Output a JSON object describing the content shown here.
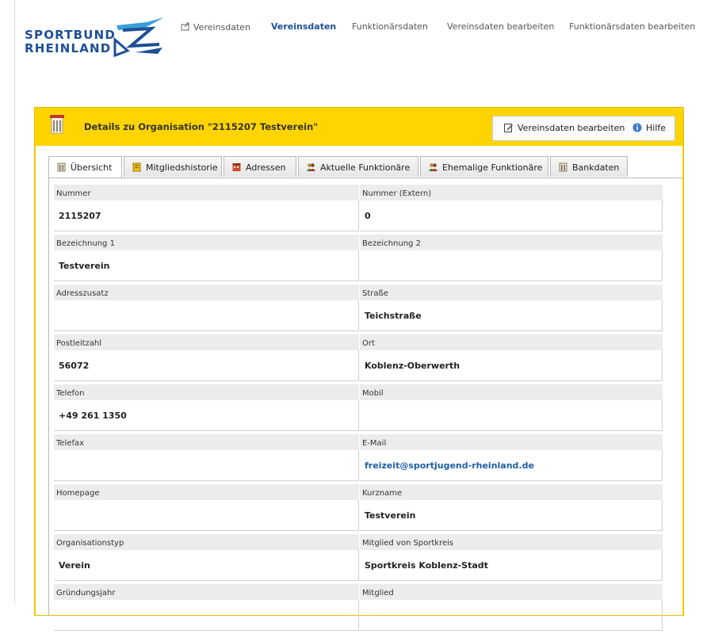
{
  "brand": {
    "line1": "SPORTBUND",
    "line2": "RHEINLAND"
  },
  "nav": [
    {
      "label": "Vereinsdaten",
      "icon": "share-icon",
      "active": false
    },
    {
      "label": "Vereinsdaten",
      "active": true
    },
    {
      "label": "Funktionärsdaten",
      "active": false
    },
    {
      "label": "Vereinsdaten bearbeiten",
      "active": false
    },
    {
      "label": "Funktionärsdaten bearbeiten",
      "active": false
    }
  ],
  "panel": {
    "title": "Details zu  Organisation \"2115207 Testverein\"",
    "edit_button": "Vereinsdaten bearbeiten",
    "help_button": "Hilfe"
  },
  "tabs": [
    {
      "label": "Übersicht",
      "icon": "building-icon",
      "active": true
    },
    {
      "label": "Mitgliedshistorie",
      "icon": "history-icon",
      "active": false
    },
    {
      "label": "Adressen",
      "icon": "addresses-icon",
      "active": false
    },
    {
      "label": "Aktuelle Funktionäre",
      "icon": "people-icon",
      "active": false
    },
    {
      "label": "Ehemalige Funktionäre",
      "icon": "people-icon",
      "active": false
    },
    {
      "label": "Bankdaten",
      "icon": "building-icon",
      "active": false
    }
  ],
  "fields_left": [
    {
      "label": "Nummer",
      "value": "2115207"
    },
    {
      "label": "Bezeichnung 1",
      "value": "Testverein"
    },
    {
      "label": "Adresszusatz",
      "value": ""
    },
    {
      "label": "Postleitzahl",
      "value": "56072"
    },
    {
      "label": "Telefon",
      "value": "+49 261 1350"
    },
    {
      "label": "Telefax",
      "value": ""
    },
    {
      "label": "Homepage",
      "value": ""
    },
    {
      "label": "Organisationstyp",
      "value": "Verein"
    },
    {
      "label": "Gründungsjahr",
      "value": ""
    }
  ],
  "fields_right": [
    {
      "label": "Nummer (Extern)",
      "value": "0"
    },
    {
      "label": "Bezeichnung 2",
      "value": ""
    },
    {
      "label": "Straße",
      "value": "Teichstraße"
    },
    {
      "label": "Ort",
      "value": "Koblenz-Oberwerth"
    },
    {
      "label": "Mobil",
      "value": ""
    },
    {
      "label": "E-Mail",
      "value": "freizeit@sportjugend-rheinland.de",
      "link": true
    },
    {
      "label": "Kurzname",
      "value": "Testverein"
    },
    {
      "label": "Mitglied von Sportkreis",
      "value": "Sportkreis Koblenz-Stadt"
    },
    {
      "label": "Mitglied",
      "value": ""
    }
  ],
  "colors": {
    "accent": "#ffd400",
    "brand": "#1d4f97",
    "link": "#1d5fa8"
  }
}
